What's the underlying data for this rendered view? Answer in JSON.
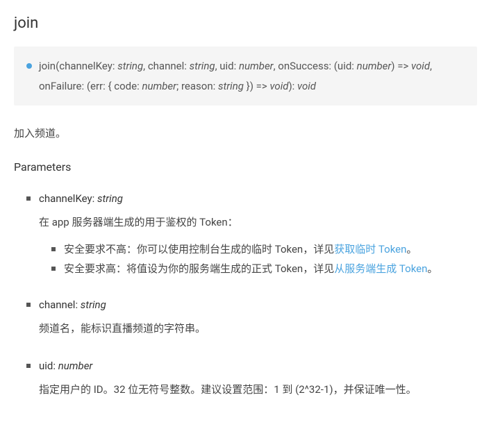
{
  "title": "join",
  "signature": {
    "fn": "join",
    "params_text": "(channelKey: ",
    "t_string1": "string",
    "p2": ", channel: ",
    "t_string2": "string",
    "p3": ", uid: ",
    "t_number1": "number",
    "p4": ", onSuccess: (uid: ",
    "t_number2": "number",
    "p5": ") => ",
    "t_void1": "void",
    "p6": ", onFailure: (err: { code: ",
    "t_number3": "number",
    "p7": "; reason: ",
    "t_string3": "string",
    "p8": " }) => ",
    "t_void2": "void",
    "p9": "): ",
    "t_void3": "void"
  },
  "description": "加入频道。",
  "parameters_heading": "Parameters",
  "params": {
    "channelKey": {
      "name": "channelKey: ",
      "type": "string",
      "desc": "在 app 服务器端生成的用于鉴权的 Token：",
      "sub1_prefix": "安全要求不高：你可以使用控制台生成的临时 Token，详见",
      "sub1_link": "获取临时 Token",
      "sub1_suffix": "。",
      "sub2_prefix": "安全要求高：将值设为你的服务端生成的正式 Token，详见",
      "sub2_link": "从服务端生成 Token",
      "sub2_suffix": "。"
    },
    "channel": {
      "name": "channel: ",
      "type": "string",
      "desc": "频道名，能标识直播频道的字符串。"
    },
    "uid": {
      "name": "uid: ",
      "type": "number",
      "desc": "指定用户的 ID。32 位无符号整数。建议设置范围：1 到 (2^32-1)，并保证唯一性。"
    }
  }
}
